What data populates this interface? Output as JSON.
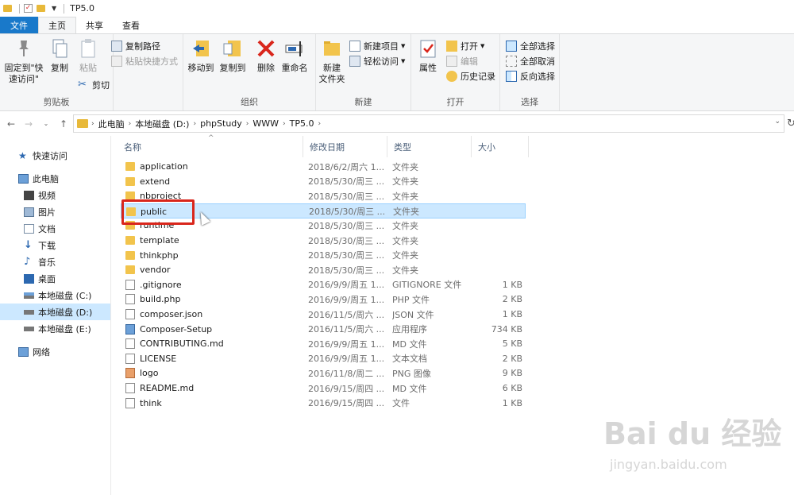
{
  "window": {
    "title": "TP5.0"
  },
  "tabs": [
    "文件",
    "主页",
    "共享",
    "查看"
  ],
  "ribbon": {
    "clipboard": {
      "label": "剪贴板",
      "pin_label_1": "固定到\"快",
      "pin_label_2": "速访问\"",
      "copy_label": "复制",
      "paste_label": "粘贴",
      "copy_path": "复制路径",
      "paste_shortcut": "粘贴快捷方式",
      "cut": "剪切"
    },
    "organize": {
      "label": "组织",
      "move_to": "移动到",
      "copy_to": "复制到",
      "delete": "删除",
      "rename": "重命名"
    },
    "new": {
      "label": "新建",
      "new_folder_1": "新建",
      "new_folder_2": "文件夹",
      "new_item": "新建项目",
      "easy_access": "轻松访问"
    },
    "open": {
      "label": "打开",
      "properties": "属性",
      "open": "打开",
      "edit": "编辑",
      "history": "历史记录"
    },
    "select": {
      "label": "选择",
      "select_all": "全部选择",
      "select_none": "全部取消",
      "invert": "反向选择"
    }
  },
  "address": {
    "crumbs": [
      "此电脑",
      "本地磁盘 (D:)",
      "phpStudy",
      "WWW",
      "TP5.0"
    ]
  },
  "nav": {
    "quick_access": "快速访问",
    "this_pc": "此电脑",
    "videos": "视频",
    "pictures": "图片",
    "documents": "文档",
    "downloads": "下载",
    "music": "音乐",
    "desktop": "桌面",
    "drive_c": "本地磁盘 (C:)",
    "drive_d": "本地磁盘 (D:)",
    "drive_e": "本地磁盘 (E:)",
    "network": "网络"
  },
  "columns": {
    "name": "名称",
    "date": "修改日期",
    "type": "类型",
    "size": "大小"
  },
  "files": [
    {
      "name": "application",
      "date": "2018/6/2/周六 1...",
      "type": "文件夹",
      "size": "",
      "icon": "folder"
    },
    {
      "name": "extend",
      "date": "2018/5/30/周三 ...",
      "type": "文件夹",
      "size": "",
      "icon": "folder"
    },
    {
      "name": "nbproject",
      "date": "2018/5/30/周三 ...",
      "type": "文件夹",
      "size": "",
      "icon": "folder"
    },
    {
      "name": "public",
      "date": "2018/5/30/周三 ...",
      "type": "文件夹",
      "size": "",
      "icon": "folder"
    },
    {
      "name": "runtime",
      "date": "2018/5/30/周三 ...",
      "type": "文件夹",
      "size": "",
      "icon": "folder"
    },
    {
      "name": "template",
      "date": "2018/5/30/周三 ...",
      "type": "文件夹",
      "size": "",
      "icon": "folder"
    },
    {
      "name": "thinkphp",
      "date": "2018/5/30/周三 ...",
      "type": "文件夹",
      "size": "",
      "icon": "folder"
    },
    {
      "name": "vendor",
      "date": "2018/5/30/周三 ...",
      "type": "文件夹",
      "size": "",
      "icon": "folder"
    },
    {
      "name": ".gitignore",
      "date": "2016/9/9/周五 1...",
      "type": "GITIGNORE 文件",
      "size": "1 KB",
      "icon": "doc"
    },
    {
      "name": "build.php",
      "date": "2016/9/9/周五 1...",
      "type": "PHP 文件",
      "size": "2 KB",
      "icon": "doc"
    },
    {
      "name": "composer.json",
      "date": "2016/11/5/周六 ...",
      "type": "JSON 文件",
      "size": "1 KB",
      "icon": "doc"
    },
    {
      "name": "Composer-Setup",
      "date": "2016/11/5/周六 ...",
      "type": "应用程序",
      "size": "734 KB",
      "icon": "exe"
    },
    {
      "name": "CONTRIBUTING.md",
      "date": "2016/9/9/周五 1...",
      "type": "MD 文件",
      "size": "5 KB",
      "icon": "doc"
    },
    {
      "name": "LICENSE",
      "date": "2016/9/9/周五 1...",
      "type": "文本文档",
      "size": "2 KB",
      "icon": "doc"
    },
    {
      "name": "logo",
      "date": "2016/11/8/周二 ...",
      "type": "PNG 图像",
      "size": "9 KB",
      "icon": "img"
    },
    {
      "name": "README.md",
      "date": "2016/9/15/周四 ...",
      "type": "MD 文件",
      "size": "6 KB",
      "icon": "doc"
    },
    {
      "name": "think",
      "date": "2016/9/15/周四 ...",
      "type": "文件",
      "size": "1 KB",
      "icon": "doc"
    }
  ],
  "selected_index": 3,
  "watermark": {
    "brand": "Bai du 经验",
    "url": "jingyan.baidu.com"
  }
}
